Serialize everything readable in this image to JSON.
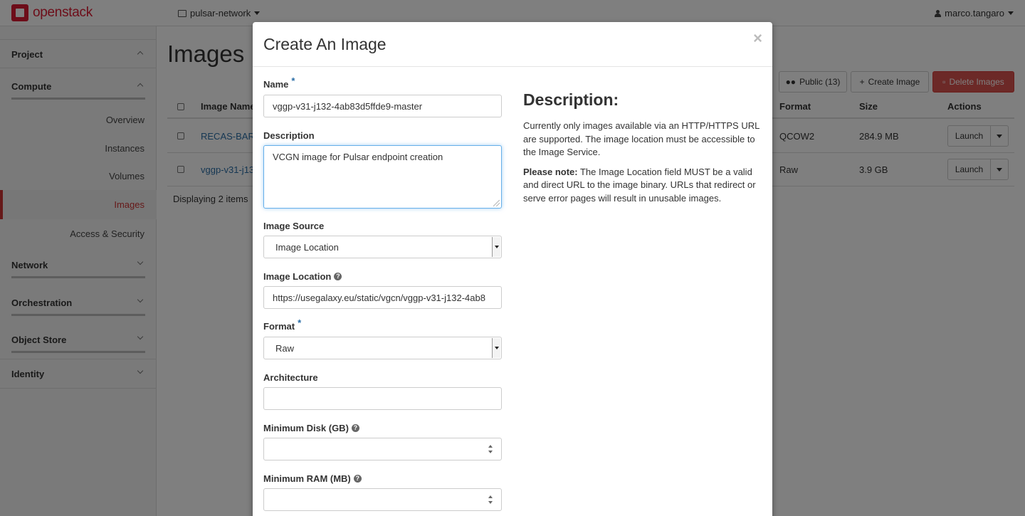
{
  "topbar": {
    "logo_text": "openstack",
    "project": "pulsar-network",
    "user": "marco.tangaro"
  },
  "sidebar": {
    "groups": {
      "project": "Project",
      "compute": "Compute",
      "network": "Network",
      "orchestration": "Orchestration",
      "object_store": "Object Store",
      "identity": "Identity"
    },
    "items": {
      "overview": "Overview",
      "instances": "Instances",
      "volumes": "Volumes",
      "images": "Images",
      "access_security": "Access & Security"
    }
  },
  "page": {
    "title": "Images",
    "public_button": "Public (13)",
    "create_button": "Create Image",
    "delete_button": "Delete Images",
    "columns": {
      "name": "Image Name",
      "format": "Format",
      "size": "Size",
      "actions": "Actions"
    },
    "rows": [
      {
        "name": "RECAS-BAR",
        "format": "QCOW2",
        "size": "284.9 MB",
        "action": "Launch"
      },
      {
        "name": "vggp-v31-j13",
        "format": "Raw",
        "size": "3.9 GB",
        "action": "Launch"
      }
    ],
    "count": "Displaying 2 items"
  },
  "modal": {
    "title": "Create An Image",
    "close": "×",
    "name_label": "Name",
    "name_value": "vggp-v31-j132-4ab83d5ffde9-master",
    "description_label": "Description",
    "description_value": "VCGN image for Pulsar endpoint creation",
    "source_label": "Image Source",
    "source_value": "Image Location",
    "location_label": "Image Location",
    "location_value": "https://usegalaxy.eu/static/vgcn/vggp-v31-j132-4ab8",
    "format_label": "Format",
    "format_value": "Raw",
    "architecture_label": "Architecture",
    "architecture_value": "",
    "min_disk_label": "Minimum Disk (GB)",
    "min_disk_value": "",
    "min_ram_label": "Minimum RAM (MB)",
    "min_ram_value": "",
    "required_mark": "*",
    "help_mark": "?",
    "help_heading": "Description:",
    "help_p1": "Currently only images available via an HTTP/HTTPS URL are supported. The image location must be accessible to the Image Service.",
    "help_p2_bold": "Please note:",
    "help_p2_rest": " The Image Location field MUST be a valid and direct URL to the image binary. URLs that redirect or serve error pages will result in unusable images."
  }
}
